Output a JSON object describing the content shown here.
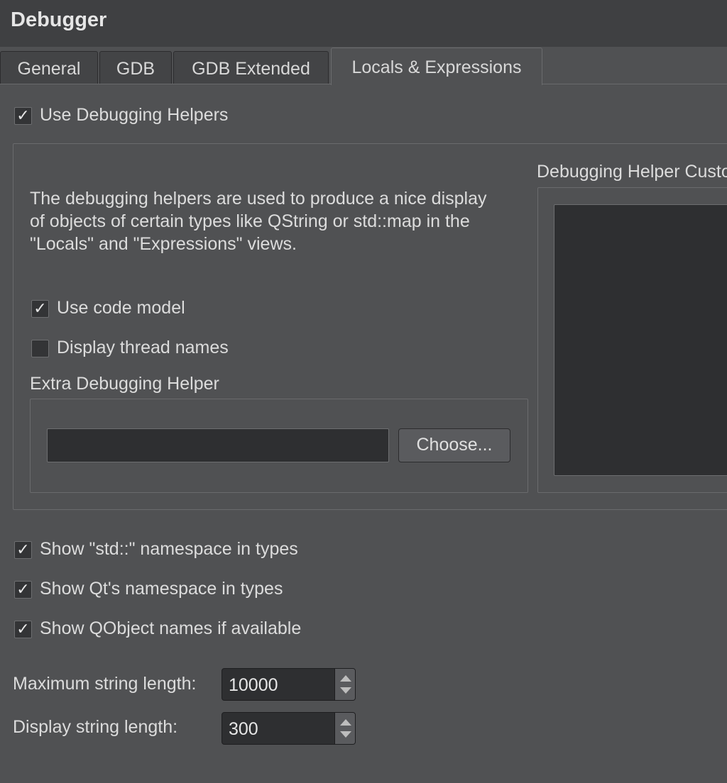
{
  "window": {
    "title": "Debugger"
  },
  "tabs": [
    {
      "label": "General",
      "active": false
    },
    {
      "label": "GDB",
      "active": false
    },
    {
      "label": "GDB Extended",
      "active": false
    },
    {
      "label": "Locals & Expressions",
      "active": true
    }
  ],
  "use_helpers": {
    "label": "Use Debugging Helpers",
    "checked": true,
    "check_glyph": "✓"
  },
  "helpers_group": {
    "description": "The debugging helpers are used to produce a nice display\nof objects of certain types like QString or std::map in the\n\"Locals\" and \"Expressions\" views.",
    "use_code_model": {
      "label": "Use code model",
      "checked": true,
      "check_glyph": "✓"
    },
    "display_thread_names": {
      "label": "Display thread names",
      "checked": false,
      "check_glyph": ""
    },
    "extra_helper": {
      "title": "Extra Debugging Helper",
      "path_value": "",
      "choose_label": "Choose..."
    },
    "customization": {
      "title": "Debugging Helper Customization"
    }
  },
  "options": [
    {
      "label": "Show \"std::\" namespace in types",
      "checked": true,
      "check_glyph": "✓"
    },
    {
      "label": "Show Qt's namespace in types",
      "checked": true,
      "check_glyph": "✓"
    },
    {
      "label": "Show QObject names if available",
      "checked": true,
      "check_glyph": "✓"
    }
  ],
  "max_string_length": {
    "label": "Maximum string length:",
    "value": "10000"
  },
  "display_string_length": {
    "label": "Display string length:",
    "value": "300"
  }
}
